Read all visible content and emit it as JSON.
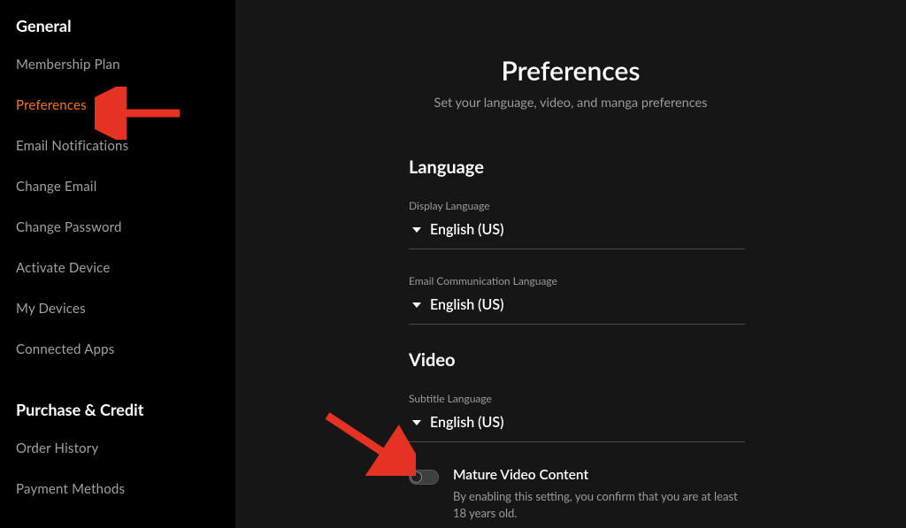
{
  "sidebar": {
    "group1_title": "General",
    "group2_title": "Purchase & Credit",
    "items1": [
      {
        "label": "Membership Plan"
      },
      {
        "label": "Preferences"
      },
      {
        "label": "Email Notifications"
      },
      {
        "label": "Change Email"
      },
      {
        "label": "Change Password"
      },
      {
        "label": "Activate Device"
      },
      {
        "label": "My Devices"
      },
      {
        "label": "Connected Apps"
      }
    ],
    "items2": [
      {
        "label": "Order History"
      },
      {
        "label": "Payment Methods"
      }
    ]
  },
  "page": {
    "title": "Preferences",
    "subtitle": "Set your language, video, and manga preferences"
  },
  "language": {
    "section_title": "Language",
    "display_label": "Display Language",
    "display_value": "English (US)",
    "email_label": "Email Communication Language",
    "email_value": "English (US)"
  },
  "video": {
    "section_title": "Video",
    "subtitle_label": "Subtitle Language",
    "subtitle_value": "English (US)",
    "mature_title": "Mature Video Content",
    "mature_desc": "By enabling this setting, you confirm that you are at least 18 years old.",
    "mature_on": false
  },
  "colors": {
    "accent": "#f47521"
  }
}
